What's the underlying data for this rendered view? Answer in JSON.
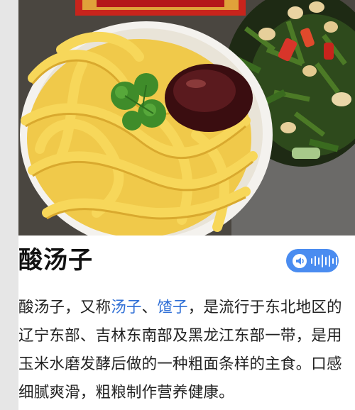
{
  "entry": {
    "title": "酸汤子",
    "desc_parts": {
      "p1": "酸汤子，又称",
      "link1": "汤子",
      "sep": "、",
      "link2": "馇子",
      "p2": "，是流行于东北地区的辽宁东部、吉林东南部及黑龙江东部一带，是用玉米水磨发酵后做的一种粗面条样的主食。口感细腻爽滑，粗粮制作营养健康。"
    }
  },
  "icons": {
    "audio": "speaker-icon",
    "wave": "soundwave-icon"
  },
  "colors": {
    "link": "#2f6fd6",
    "audio_button": "#4a8cf0",
    "title": "#111111"
  }
}
